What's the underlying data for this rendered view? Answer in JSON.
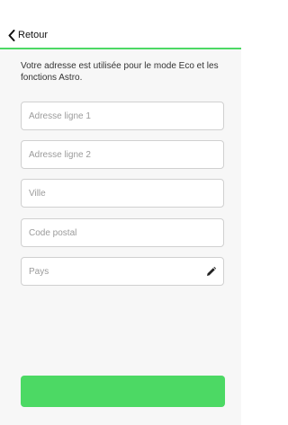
{
  "nav": {
    "back_label": "Retour"
  },
  "intro_text": "Votre adresse est utilisée pour  le mode Eco et les fonctions Astro.",
  "form": {
    "address_line_1": {
      "value": "",
      "placeholder": "Adresse ligne 1"
    },
    "address_line_2": {
      "value": "",
      "placeholder": "Adresse ligne 2"
    },
    "city": {
      "value": "",
      "placeholder": "Ville"
    },
    "postal_code": {
      "value": "",
      "placeholder": "Code postal"
    },
    "country": {
      "value": "",
      "placeholder": "Pays"
    }
  },
  "submit_label": "",
  "icons": {
    "back": "chevron-left-icon",
    "country_edit": "pencil-icon"
  },
  "colors": {
    "accent": "#4cd964",
    "background": "#f7f7f7",
    "field_border": "#d0d0d0",
    "placeholder": "#9b9b9b"
  }
}
